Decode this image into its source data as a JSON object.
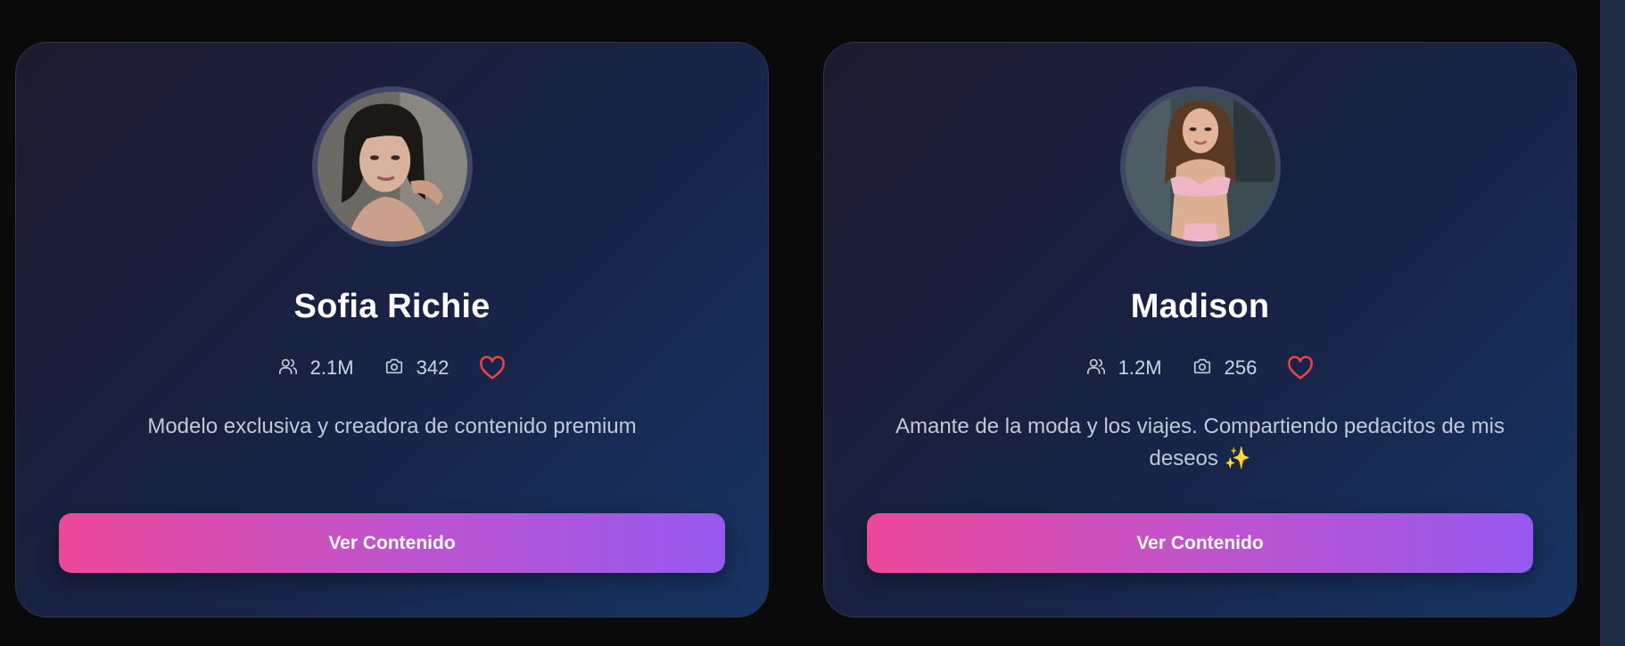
{
  "cards": [
    {
      "name": "Sofia Richie",
      "followers": "2.1M",
      "posts": "342",
      "description": "Modelo exclusiva y creadora de contenido premium",
      "button_label": "Ver Contenido"
    },
    {
      "name": "Madison",
      "followers": "1.2M",
      "posts": "256",
      "description": "Amante de la moda y los viajes. Compartiendo pedacitos de mis deseos ✨",
      "button_label": "Ver Contenido"
    }
  ],
  "icons": {
    "followers": "users-icon",
    "posts": "camera-icon",
    "favorite": "heart-icon"
  },
  "colors": {
    "page_background": "#0a0a0b",
    "heart": "#ef4444",
    "button_gradient_start": "#ec4899",
    "button_gradient_end": "#9558ee"
  }
}
